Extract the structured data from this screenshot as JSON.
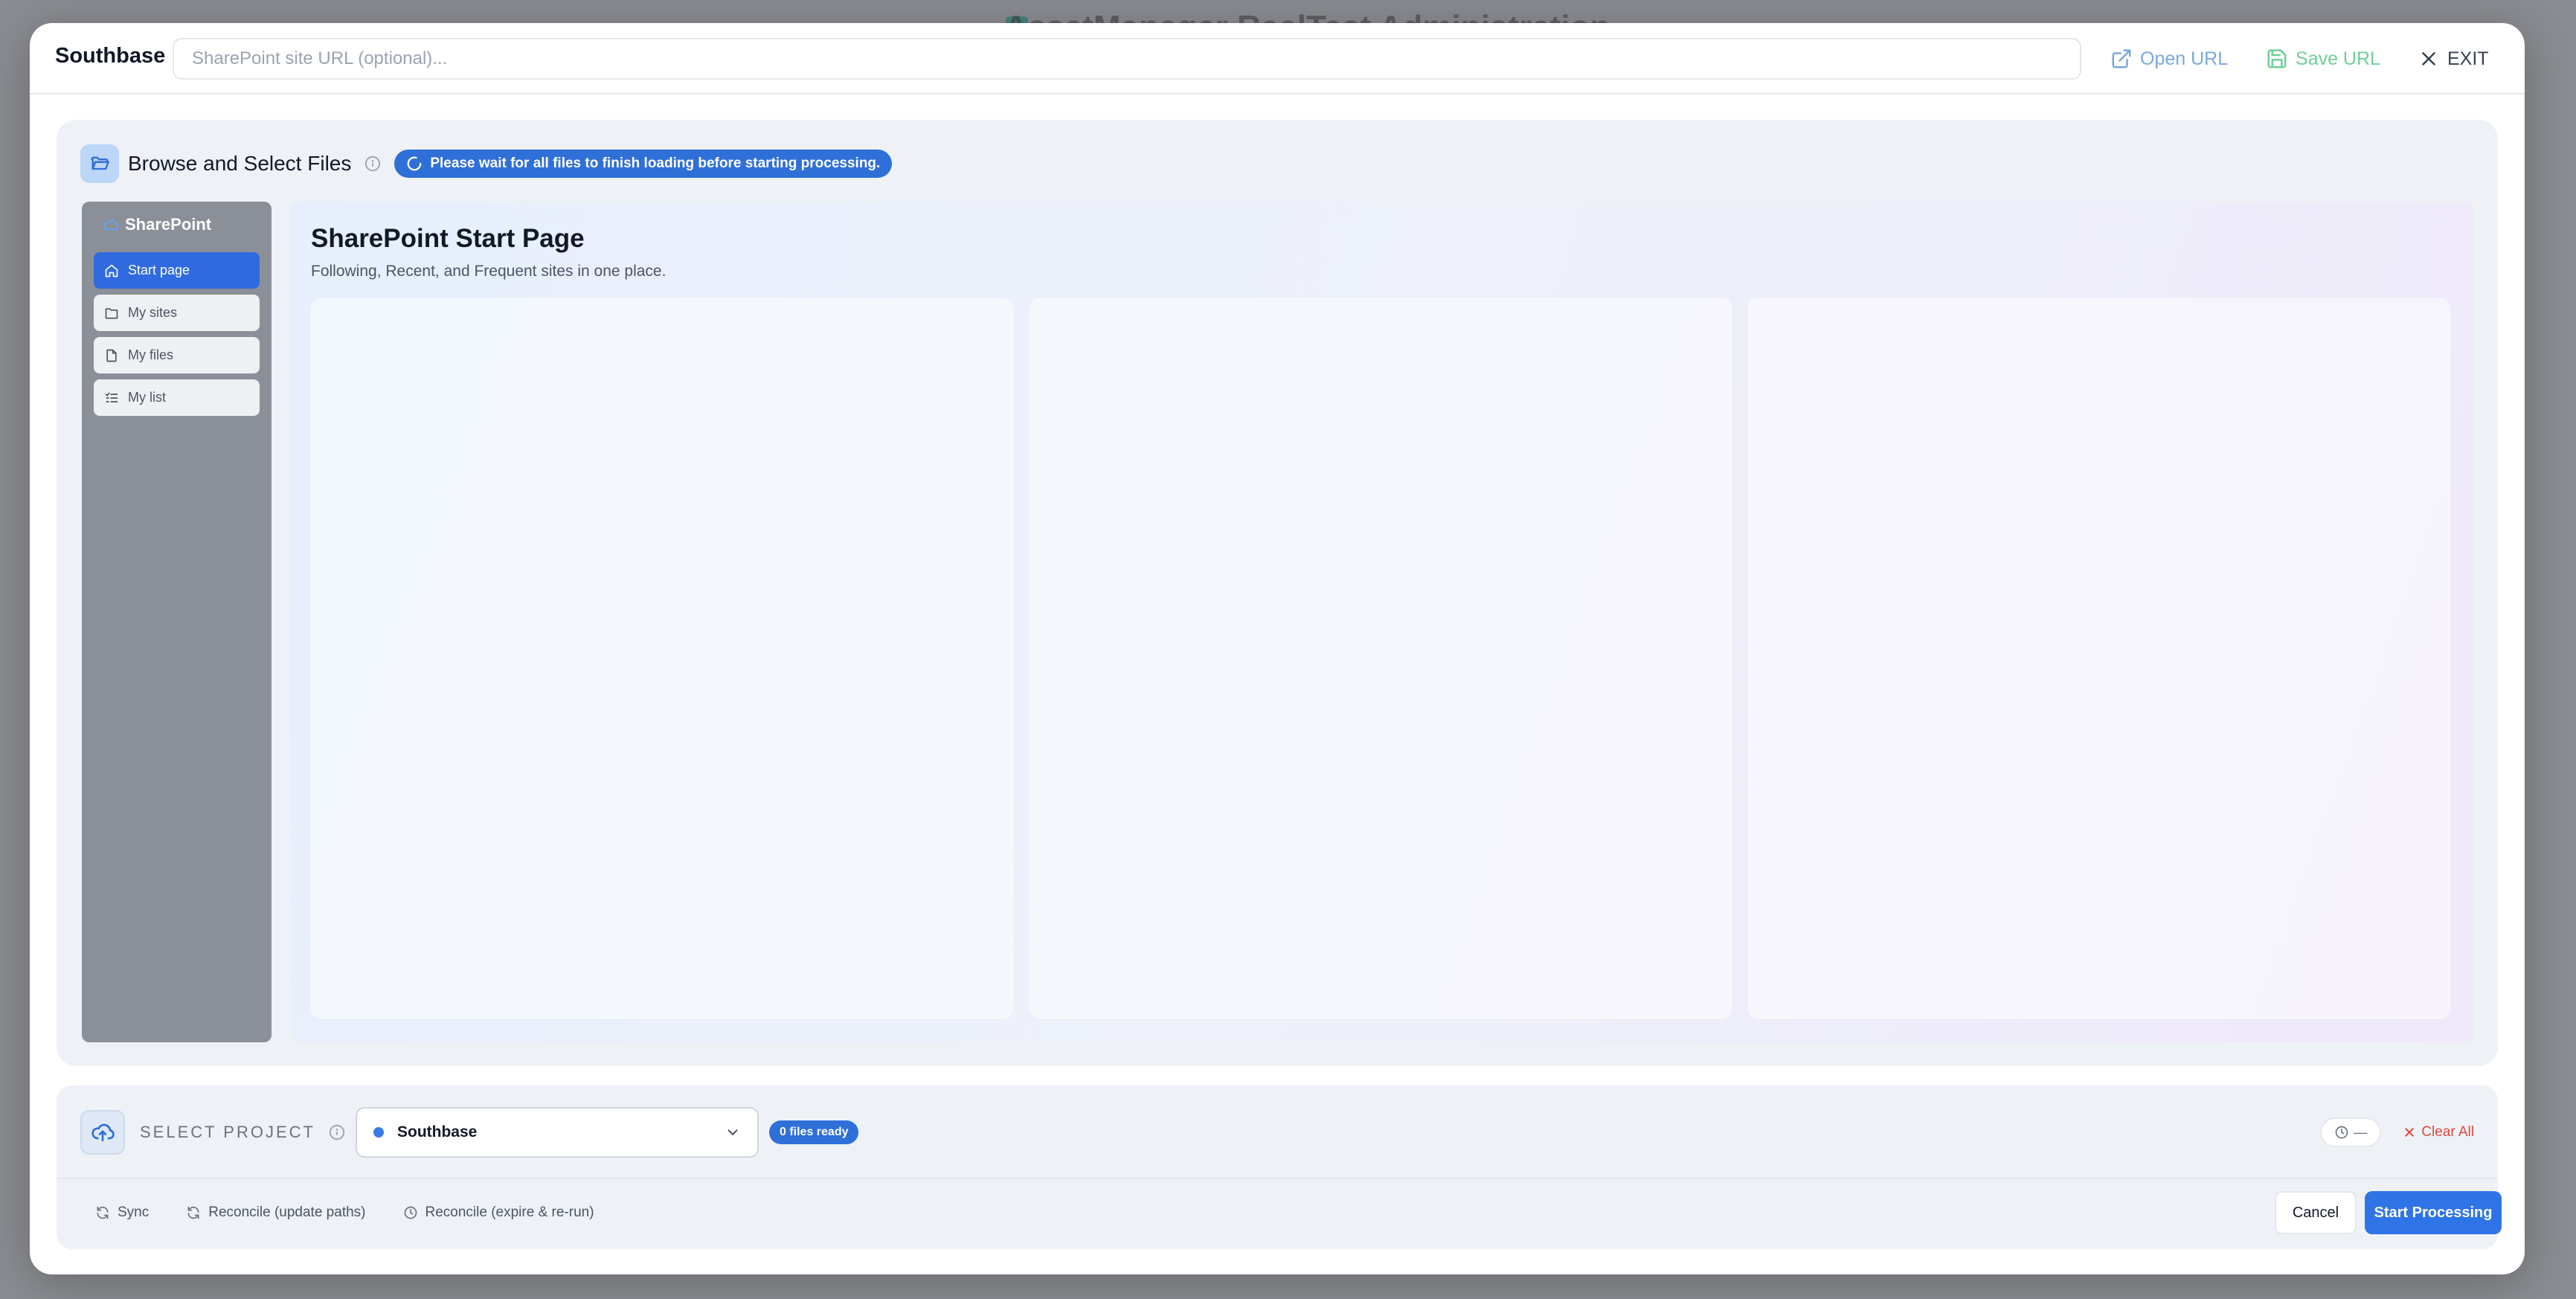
{
  "background": {
    "app_title": "AssetManager RealTest Administration"
  },
  "topbar": {
    "project_name": "Southbase",
    "url_placeholder": "SharePoint site URL (optional)...",
    "url_value": "",
    "open_url_label": "Open URL",
    "save_url_label": "Save URL",
    "exit_label": "EXIT"
  },
  "browse": {
    "title": "Browse and Select Files",
    "loading_notice": "Please wait for all files to finish loading before starting processing."
  },
  "sidebar": {
    "heading": "SharePoint",
    "items": [
      {
        "label": "Start page",
        "icon": "home-icon",
        "active": true
      },
      {
        "label": "My sites",
        "icon": "folder-icon",
        "active": false
      },
      {
        "label": "My files",
        "icon": "file-icon",
        "active": false
      },
      {
        "label": "My list",
        "icon": "list-icon",
        "active": false
      }
    ]
  },
  "content": {
    "title": "SharePoint Start Page",
    "subtitle": "Following, Recent, and Frequent sites in one place."
  },
  "bottom": {
    "select_label": "SELECT PROJECT",
    "selected_project": "Southbase",
    "files_ready": "0 files ready",
    "timer_value": "—",
    "clear_all_label": "Clear All",
    "sync_label": "Sync",
    "reconcile_update_label": "Reconcile (update paths)",
    "reconcile_expire_label": "Reconcile (expire & re-run)",
    "cancel_label": "Cancel",
    "start_label": "Start Processing"
  },
  "colors": {
    "accent": "#2f6fd8",
    "open_url": "#7aa7e0",
    "save_url": "#6fcf97",
    "danger": "#e0483e",
    "sidebar_bg": "#8b8f97"
  }
}
